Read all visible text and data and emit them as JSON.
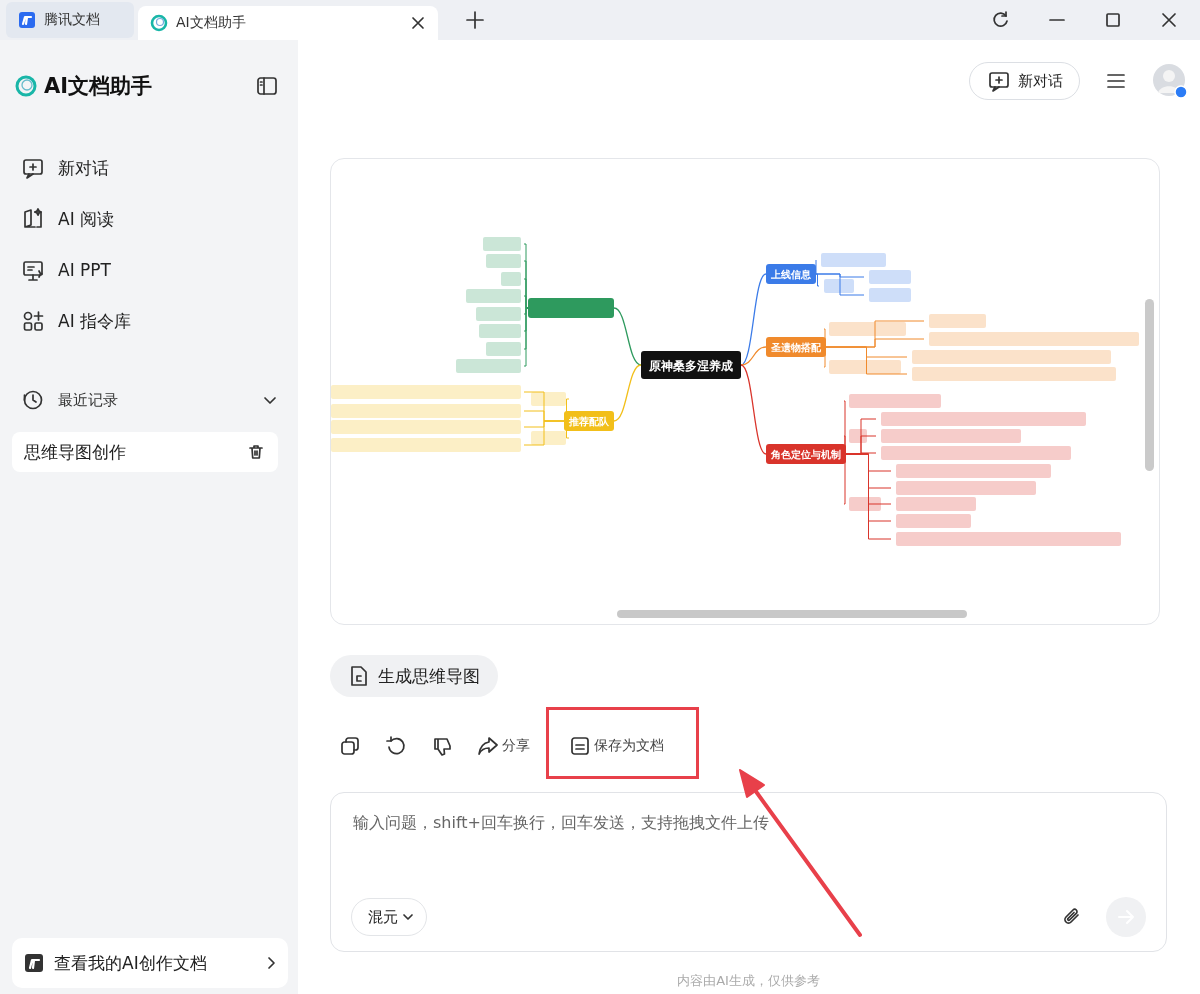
{
  "browser_tabs": [
    {
      "label": "腾讯文档",
      "kind": "docs",
      "selected": false
    },
    {
      "label": "AI文档助手",
      "kind": "assistant",
      "selected": true
    }
  ],
  "sidebar": {
    "title": "AI文档助手",
    "nav": [
      {
        "label": "新对话",
        "kind": "chat"
      },
      {
        "label": "AI 阅读",
        "kind": "read"
      },
      {
        "label": "AI PPT",
        "kind": "ppt"
      },
      {
        "label": "AI 指令库",
        "kind": "prompts"
      }
    ],
    "recent": {
      "label": "最近记录",
      "expanded": true,
      "items": [
        {
          "label": "思维导图创作",
          "selected": true
        }
      ]
    },
    "footer_link": "查看我的AI创作文档"
  },
  "header": {
    "new_chat": "新对话"
  },
  "mind_map": {
    "root": "原神桑多涅养成",
    "branches": [
      {
        "label": "上线信息",
        "color": "#3b7be8",
        "on_left": false
      },
      {
        "label": "圣遗物搭配",
        "color": "#f08a2c",
        "on_left": false
      },
      {
        "label": "角色定位与机制",
        "color": "#d9342b",
        "on_left": false
      },
      {
        "color": "#2e9a5e",
        "on_left": true
      },
      {
        "label": "推荐配队",
        "color": "#f2bf1a",
        "on_left": true
      }
    ]
  },
  "generate_button": "生成思维导图",
  "actions": [
    {
      "kind": "copy",
      "highlighted": false
    },
    {
      "kind": "regenerate",
      "highlighted": false
    },
    {
      "kind": "dislike",
      "highlighted": false
    },
    {
      "kind": "share",
      "label": "分享",
      "highlighted": false
    },
    {
      "kind": "save",
      "label": "保存为文档",
      "highlighted": true
    }
  ],
  "composer": {
    "placeholder": "输入问题，shift+回车换行，回车发送，支持拖拽文件上传",
    "model": "混元",
    "send_disabled": true
  },
  "disclaimer": "内容由AI生成，仅供参考"
}
